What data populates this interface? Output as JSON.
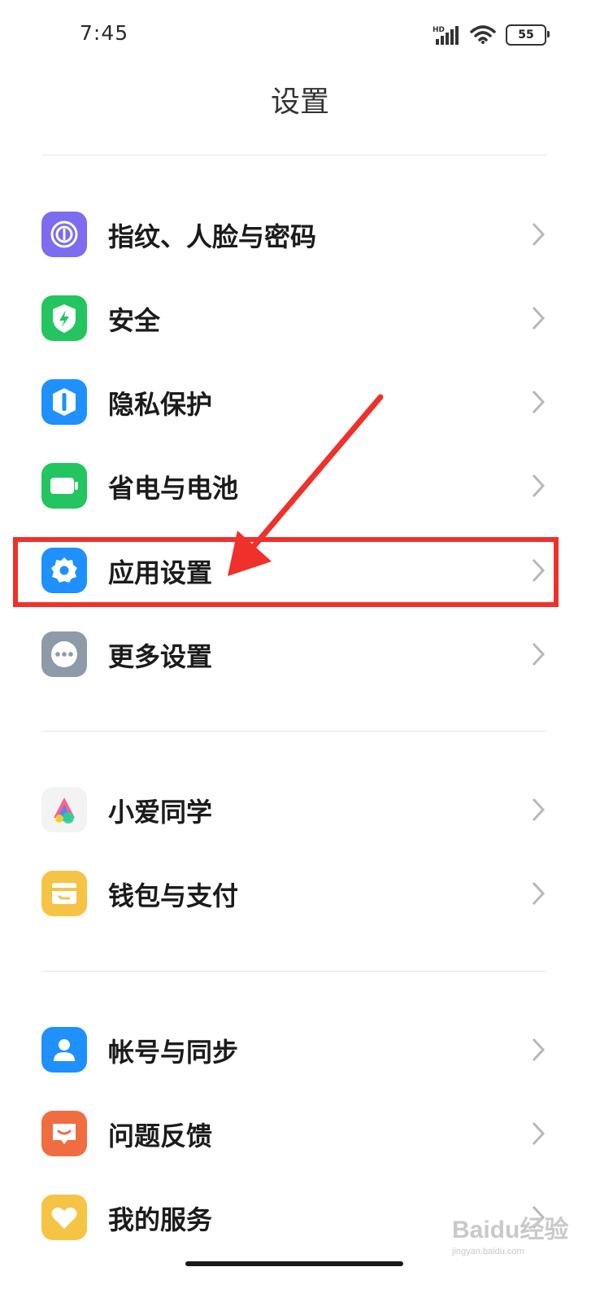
{
  "status_bar": {
    "time": "7:45",
    "network": "HD",
    "battery": "55"
  },
  "header": {
    "title": "设置"
  },
  "groups": [
    {
      "items": [
        {
          "label": "指纹、人脸与密码",
          "icon": "fingerprint-icon",
          "color": "#7b6cf0"
        },
        {
          "label": "安全",
          "icon": "shield-bolt-icon",
          "color": "#22c55e"
        },
        {
          "label": "隐私保护",
          "icon": "privacy-icon",
          "color": "#1e90ff"
        },
        {
          "label": "省电与电池",
          "icon": "battery-icon",
          "color": "#22c55e"
        },
        {
          "label": "应用设置",
          "icon": "gear-icon",
          "color": "#1e90ff"
        },
        {
          "label": "更多设置",
          "icon": "more-dots-icon",
          "color": "#8e9aa8"
        }
      ]
    },
    {
      "items": [
        {
          "label": "小爱同学",
          "icon": "xiaoai-icon",
          "color": "#f3f3f3"
        },
        {
          "label": "钱包与支付",
          "icon": "wallet-icon",
          "color": "#f6c445"
        }
      ]
    },
    {
      "items": [
        {
          "label": "帐号与同步",
          "icon": "account-icon",
          "color": "#1e90ff"
        },
        {
          "label": "问题反馈",
          "icon": "feedback-icon",
          "color": "#f26c42"
        },
        {
          "label": "我的服务",
          "icon": "heart-icon",
          "color": "#f6c445"
        }
      ]
    }
  ],
  "annotation": {
    "highlight_color": "#f0302a"
  },
  "watermark": {
    "text": "Baidu经验",
    "sub": "jingyan.baidu.com"
  }
}
